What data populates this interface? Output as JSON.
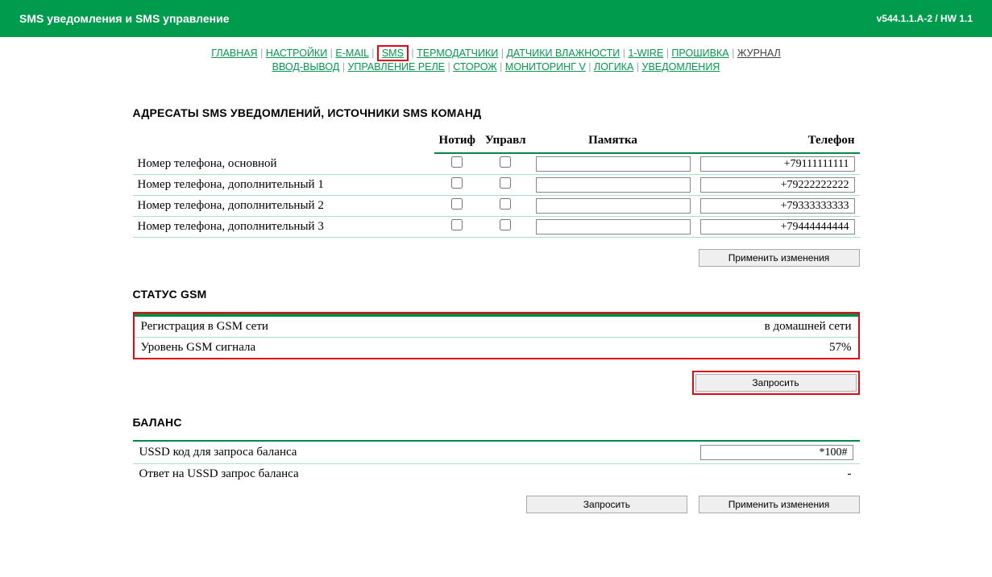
{
  "header": {
    "title": "SMS уведомления и SMS управление",
    "version": "v544.1.1.A-2 / HW 1.1"
  },
  "nav": {
    "row1": [
      "ГЛАВНАЯ",
      "НАСТРОЙКИ",
      "E-MAIL",
      "SMS",
      "ТЕРМОДАТЧИКИ",
      "ДАТЧИКИ ВЛАЖНОСТИ",
      "1-WIRE",
      "ПРОШИВКА",
      "ЖУРНАЛ"
    ],
    "row2": [
      "ВВОД-ВЫВОД",
      "УПРАВЛЕНИЕ РЕЛЕ",
      "СТОРОЖ",
      "МОНИТОРИНГ V",
      "ЛОГИКА",
      "УВЕДОМЛЕНИЯ"
    ]
  },
  "sections": {
    "recipients_title": "АДРЕСАТЫ SMS УВЕДОМЛЕНИЙ, ИСТОЧНИКИ SMS КОМАНД",
    "columns": {
      "notif": "Нотиф",
      "manage": "Управл",
      "note": "Памятка",
      "phone": "Телефон"
    },
    "rows": [
      {
        "label": "Номер телефона, основной",
        "note": "",
        "phone": "+79111111111"
      },
      {
        "label": "Номер телефона, дополнительный 1",
        "note": "",
        "phone": "+79222222222"
      },
      {
        "label": "Номер телефона, дополнительный 2",
        "note": "",
        "phone": "+79333333333"
      },
      {
        "label": "Номер телефона, дополнительный 3",
        "note": "",
        "phone": "+79444444444"
      }
    ],
    "apply_btn": "Применить изменения",
    "gsm_title": "СТАТУС GSM",
    "gsm_rows": [
      {
        "label": "Регистрация в GSM сети",
        "value": "в домашней сети"
      },
      {
        "label": "Уровень GSM сигнала",
        "value": "57%"
      }
    ],
    "request_btn": "Запросить",
    "balance_title": "БАЛАНС",
    "balance_rows": {
      "ussd_label": "USSD код для запроса баланса",
      "ussd_value": "*100#",
      "answer_label": "Ответ на USSD запрос баланса",
      "answer_value": "-"
    },
    "balance_request_btn": "Запросить",
    "balance_apply_btn": "Применить изменения"
  }
}
